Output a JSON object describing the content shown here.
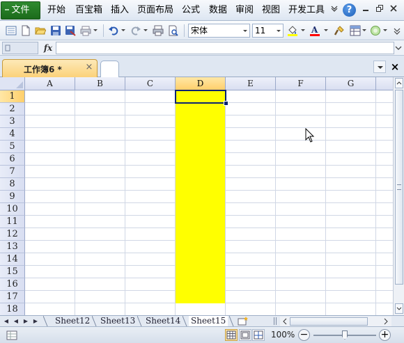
{
  "menubar": {
    "file": "文件",
    "items": [
      "开始",
      "百宝箱",
      "插入",
      "页面布局",
      "公式",
      "数据",
      "审阅",
      "视图",
      "开发工具"
    ],
    "help": "?"
  },
  "toolbar": {
    "font_name": "宋体",
    "font_size": "11",
    "accent_fill": "#ffff00",
    "accent_font": "#ff0000"
  },
  "formula_bar": {
    "fx": "fx",
    "name_box": "",
    "content": ""
  },
  "document_tab": {
    "label": "工作簿6 *",
    "close": "×"
  },
  "grid": {
    "columns": [
      "A",
      "B",
      "C",
      "D",
      "E",
      "F",
      "G"
    ],
    "rows": [
      "1",
      "2",
      "3",
      "4",
      "5",
      "6",
      "7",
      "8",
      "9",
      "10",
      "11",
      "12",
      "13",
      "14",
      "15",
      "16",
      "17",
      "18"
    ],
    "active_column": "D",
    "active_row": "1",
    "highlight_color": "#ffff00"
  },
  "sheets": [
    "Sheet12",
    "Sheet13",
    "Sheet14",
    "Sheet15"
  ],
  "active_sheet": "Sheet15",
  "status": {
    "zoom": "100%",
    "zoom_out": "−",
    "zoom_in": "+"
  }
}
